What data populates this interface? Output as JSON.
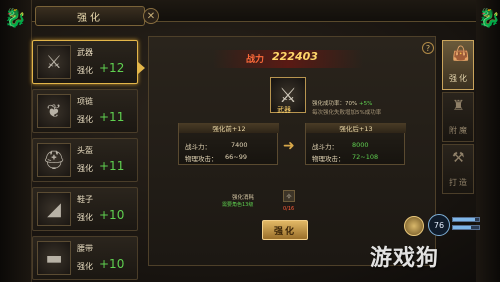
{
  "window": {
    "title": "强化",
    "close_glyph": "✕"
  },
  "equipment": [
    {
      "name": "武器",
      "level_label": "强化",
      "level": "+12",
      "icon": "sword-icon",
      "glyph": "⚔"
    },
    {
      "name": "项链",
      "level_label": "强化",
      "level": "+11",
      "icon": "necklace-icon",
      "glyph": "❦"
    },
    {
      "name": "头盔",
      "level_label": "强化",
      "level": "+11",
      "icon": "helmet-icon",
      "glyph": "⛑"
    },
    {
      "name": "鞋子",
      "level_label": "强化",
      "level": "+10",
      "icon": "boots-icon",
      "glyph": "◢"
    },
    {
      "name": "腰带",
      "level_label": "强化",
      "level": "+10",
      "icon": "belt-icon",
      "glyph": "▬"
    }
  ],
  "power": {
    "label": "战力",
    "value": "222403"
  },
  "weapon": {
    "tag": "武器",
    "glyph": "⚔"
  },
  "rate": {
    "line1": "强化成功率：70%",
    "line1_plus": "+5%",
    "line2": "每次强化失败增加5%成功率"
  },
  "before": {
    "header": "强化前+12",
    "power_label": "战斗力：",
    "power_value": "7400",
    "attack_label": "物理攻击：",
    "attack_value": "66~99"
  },
  "after": {
    "header": "强化后+13",
    "power_label": "战斗力：",
    "power_value": "8000",
    "attack_label": "物理攻击：",
    "attack_value": "72~108"
  },
  "arrow_glyph": "➜",
  "cost": {
    "label": "强化消耗",
    "desc": "需要角色13级",
    "count": "0/16",
    "glyph": "✧"
  },
  "strengthen_button": "强化",
  "help_glyph": "?",
  "tabs": [
    {
      "label": "强化",
      "icon": "bag-icon",
      "glyph": "👜"
    },
    {
      "label": "附魔",
      "icon": "enchant-icon",
      "glyph": "♜"
    },
    {
      "label": "打造",
      "icon": "forge-icon",
      "glyph": "⚒"
    }
  ],
  "player": {
    "level": "76",
    "hp_fraction": 0.85,
    "mp_fraction": 0.7
  },
  "watermark": "游戏狗",
  "colors": {
    "accent_gold": "#e3b64a",
    "level_green": "#5fd050",
    "power_red": "#ff6a3a"
  }
}
